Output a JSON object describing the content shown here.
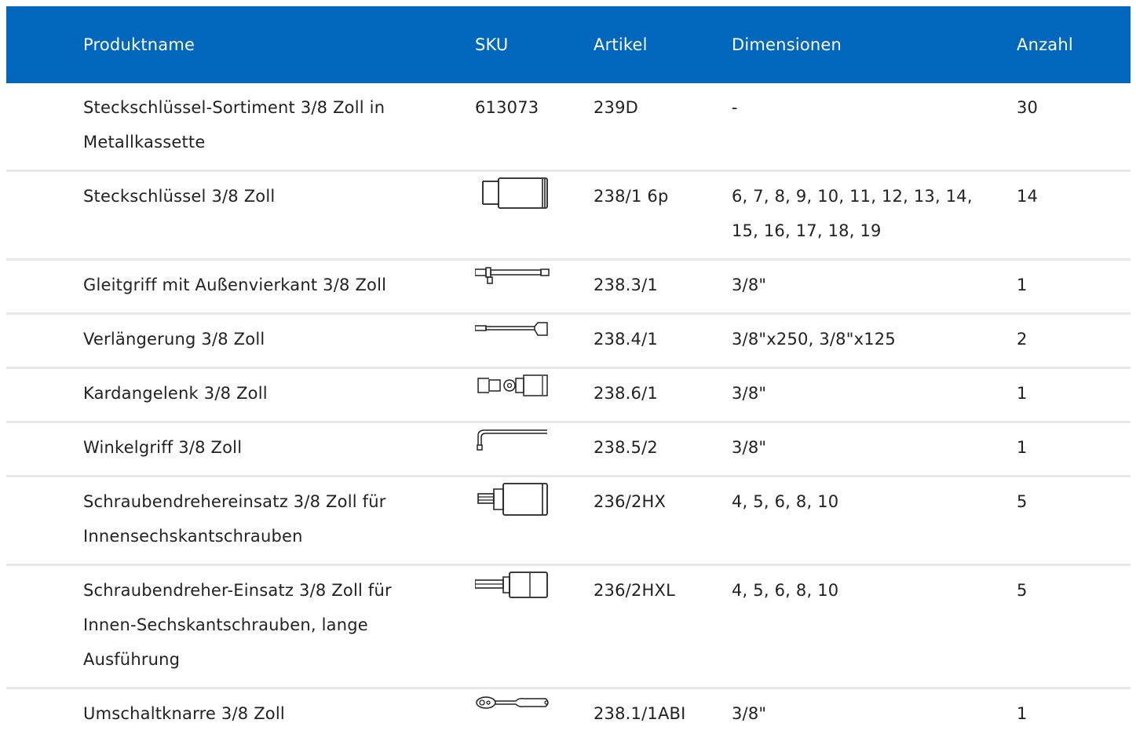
{
  "header": {
    "name": "Produktname",
    "sku": "SKU",
    "article": "Artikel",
    "dimensions": "Dimensionen",
    "quantity": "Anzahl"
  },
  "colors": {
    "header_bg": "#0067bd",
    "header_text": "#ffffff",
    "row_divider": "#e8e8e8"
  },
  "rows": [
    {
      "name": "Steckschlüssel-Sortiment 3/8 Zoll in Metallkassette",
      "sku": "613073",
      "icon": "",
      "article": "239D",
      "dimensions": "-",
      "quantity": "30"
    },
    {
      "name": "Steckschlüssel 3/8 Zoll",
      "sku": "",
      "icon": "socket-icon",
      "article": "238/1 6p",
      "dimensions": "6, 7, 8, 9, 10, 11, 12, 13, 14, 15, 16, 17, 18, 19",
      "quantity": "14"
    },
    {
      "name": "Gleitgriff mit Außenvierkant 3/8 Zoll",
      "sku": "",
      "icon": "sliding-t-handle-icon",
      "article": "238.3/1",
      "dimensions": "3/8\"",
      "quantity": "1"
    },
    {
      "name": "Verlängerung 3/8 Zoll",
      "sku": "",
      "icon": "extension-bar-icon",
      "article": "238.4/1",
      "dimensions": "3/8\"x250, 3/8\"x125",
      "quantity": "2"
    },
    {
      "name": "Kardangelenk 3/8 Zoll",
      "sku": "",
      "icon": "universal-joint-icon",
      "article": "238.6/1",
      "dimensions": "3/8\"",
      "quantity": "1"
    },
    {
      "name": "Winkelgriff 3/8 Zoll",
      "sku": "",
      "icon": "l-handle-icon",
      "article": "238.5/2",
      "dimensions": "3/8\"",
      "quantity": "1"
    },
    {
      "name": "Schraubendrehereinsatz 3/8 Zoll für Innensechskantschrauben",
      "sku": "",
      "icon": "hex-bit-socket-icon",
      "article": "236/2HX",
      "dimensions": "4, 5, 6, 8, 10",
      "quantity": "5"
    },
    {
      "name": "Schraubendreher-Einsatz 3/8 Zoll für Innen-Sechskantschrauben, lange Ausführung",
      "sku": "",
      "icon": "long-hex-bit-socket-icon",
      "article": "236/2HXL",
      "dimensions": "4, 5, 6, 8, 10",
      "quantity": "5"
    },
    {
      "name": "Umschaltknarre 3/8 Zoll",
      "sku": "",
      "icon": "ratchet-icon",
      "article": "238.1/1ABI",
      "dimensions": "3/8\"",
      "quantity": "1"
    }
  ]
}
